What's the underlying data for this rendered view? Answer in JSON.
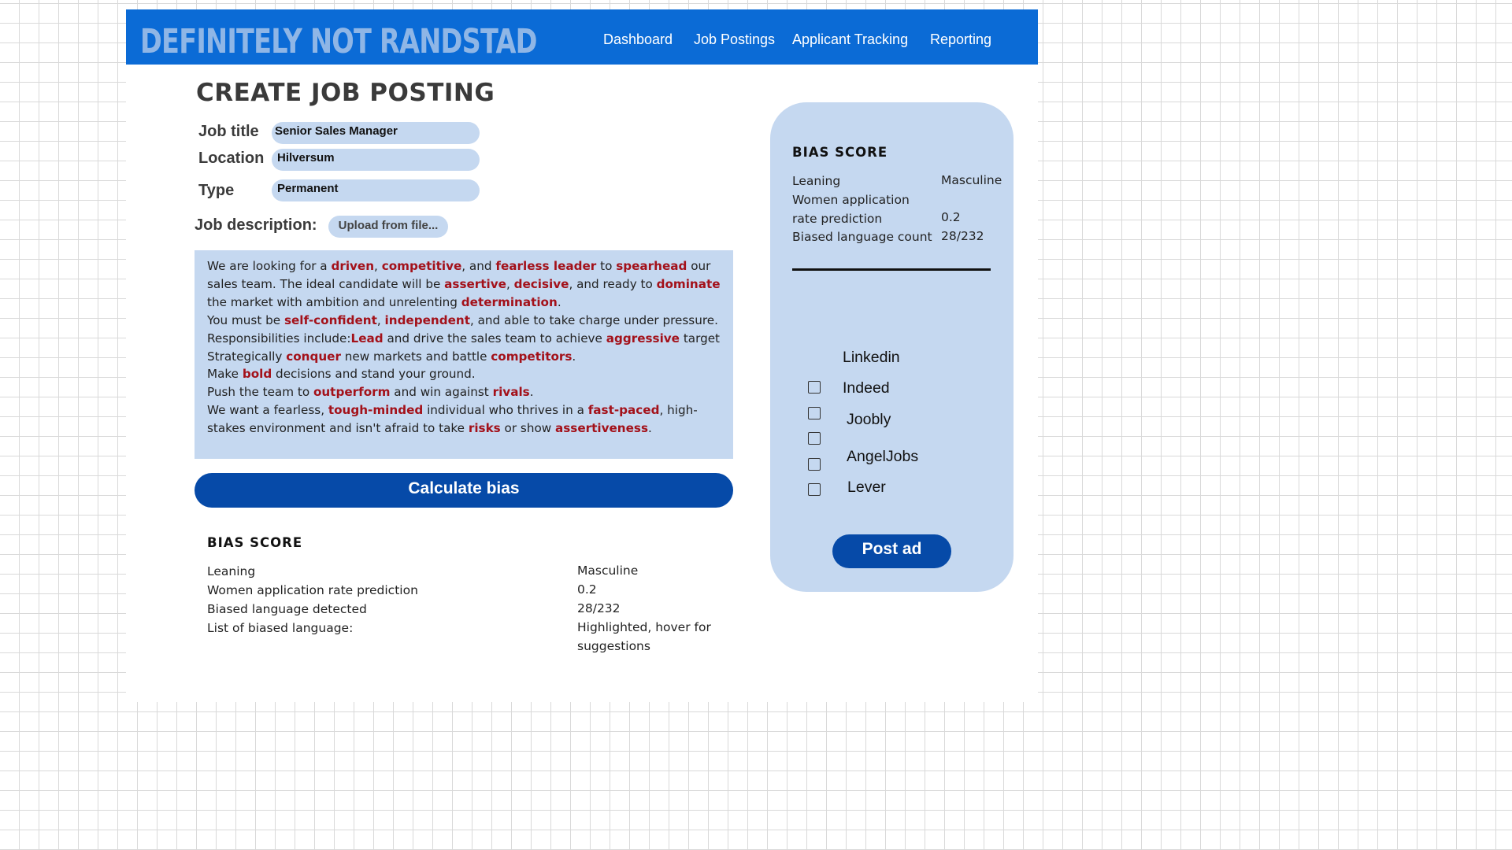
{
  "header": {
    "brand": "DEFINITELY NOT RANDSTAD",
    "nav": [
      "Dashboard",
      "Job Postings",
      "Applicant Tracking",
      "Reporting"
    ]
  },
  "page_title": "CREATE JOB POSTING",
  "form": {
    "job_title_label": "Job title",
    "job_title_value": "Senior Sales Manager",
    "location_label": "Location",
    "location_value": "Hilversum",
    "type_label": "Type",
    "type_value": "Permanent",
    "description_label": "Job description:",
    "upload_label": "Upload from file...",
    "description_segments": [
      {
        "t": " We are looking for a "
      },
      {
        "t": "driven",
        "b": true
      },
      {
        "t": ", "
      },
      {
        "t": "competitive",
        "b": true
      },
      {
        "t": ", and "
      },
      {
        "t": "fearless leader",
        "b": true
      },
      {
        "t": " to "
      },
      {
        "t": "spearhead",
        "b": true
      },
      {
        "t": " our sales team. The ideal candidate will be "
      },
      {
        "t": "assertive",
        "b": true
      },
      {
        "t": ", "
      },
      {
        "t": "decisive",
        "b": true
      },
      {
        "t": ", and ready to "
      },
      {
        "t": "dominate",
        "b": true
      },
      {
        "t": " the market with ambition and unrelenting "
      },
      {
        "t": "determination",
        "b": true
      },
      {
        "t": ".\nYou must be "
      },
      {
        "t": "self-confident",
        "b": true
      },
      {
        "t": ", "
      },
      {
        "t": "independent",
        "b": true
      },
      {
        "t": ", and able to take charge under pressure.\nResponsibilities include:"
      },
      {
        "t": "Lead",
        "b": true
      },
      {
        "t": " and drive the sales team to achieve "
      },
      {
        "t": "aggressive",
        "b": true
      },
      {
        "t": " target\nStrategically "
      },
      {
        "t": "conquer",
        "b": true
      },
      {
        "t": " new markets and battle "
      },
      {
        "t": "competitors",
        "b": true
      },
      {
        "t": ".\nMake "
      },
      {
        "t": "bold",
        "b": true
      },
      {
        "t": " decisions and stand your ground.\nPush the team to "
      },
      {
        "t": "outperform",
        "b": true
      },
      {
        "t": " and win against "
      },
      {
        "t": "rivals",
        "b": true
      },
      {
        "t": ".\nWe want a fearless, "
      },
      {
        "t": "tough-minded",
        "b": true
      },
      {
        "t": " individual who thrives in a "
      },
      {
        "t": "fast-paced",
        "b": true
      },
      {
        "t": ", high-stakes environment and isn't afraid to take "
      },
      {
        "t": "risks",
        "b": true
      },
      {
        "t": " or show "
      },
      {
        "t": "assertiveness",
        "b": true
      },
      {
        "t": "."
      }
    ],
    "calculate_label": "Calculate bias"
  },
  "bias_result": {
    "heading": "BIAS SCORE",
    "leaning_label": "Leaning",
    "leaning_value": "Masculine",
    "women_label": "Women application rate prediction",
    "women_value": "0.2",
    "detected_label": "Biased language detected",
    "detected_value": "28/232",
    "list_label": "List of biased language:",
    "list_value_line1": "Highlighted, hover for",
    "list_value_line2": "suggestions"
  },
  "side_panel": {
    "heading": "BIAS SCORE",
    "leaning_label": "Leaning",
    "leaning_value": "Masculine",
    "women_label_line1": "Women application",
    "women_label_line2": "rate prediction",
    "women_value": "0.2",
    "count_label": "Biased language count",
    "count_value": "28/232",
    "job_boards": [
      "Linkedin",
      "Indeed",
      "Joobly",
      "AngelJobs",
      "Lever"
    ],
    "post_label": "Post ad"
  },
  "colors": {
    "header_blue": "#0b6bd6",
    "button_blue": "#064aa8",
    "panel_blue": "#c5d8f0",
    "highlight_red": "#a3111a"
  }
}
